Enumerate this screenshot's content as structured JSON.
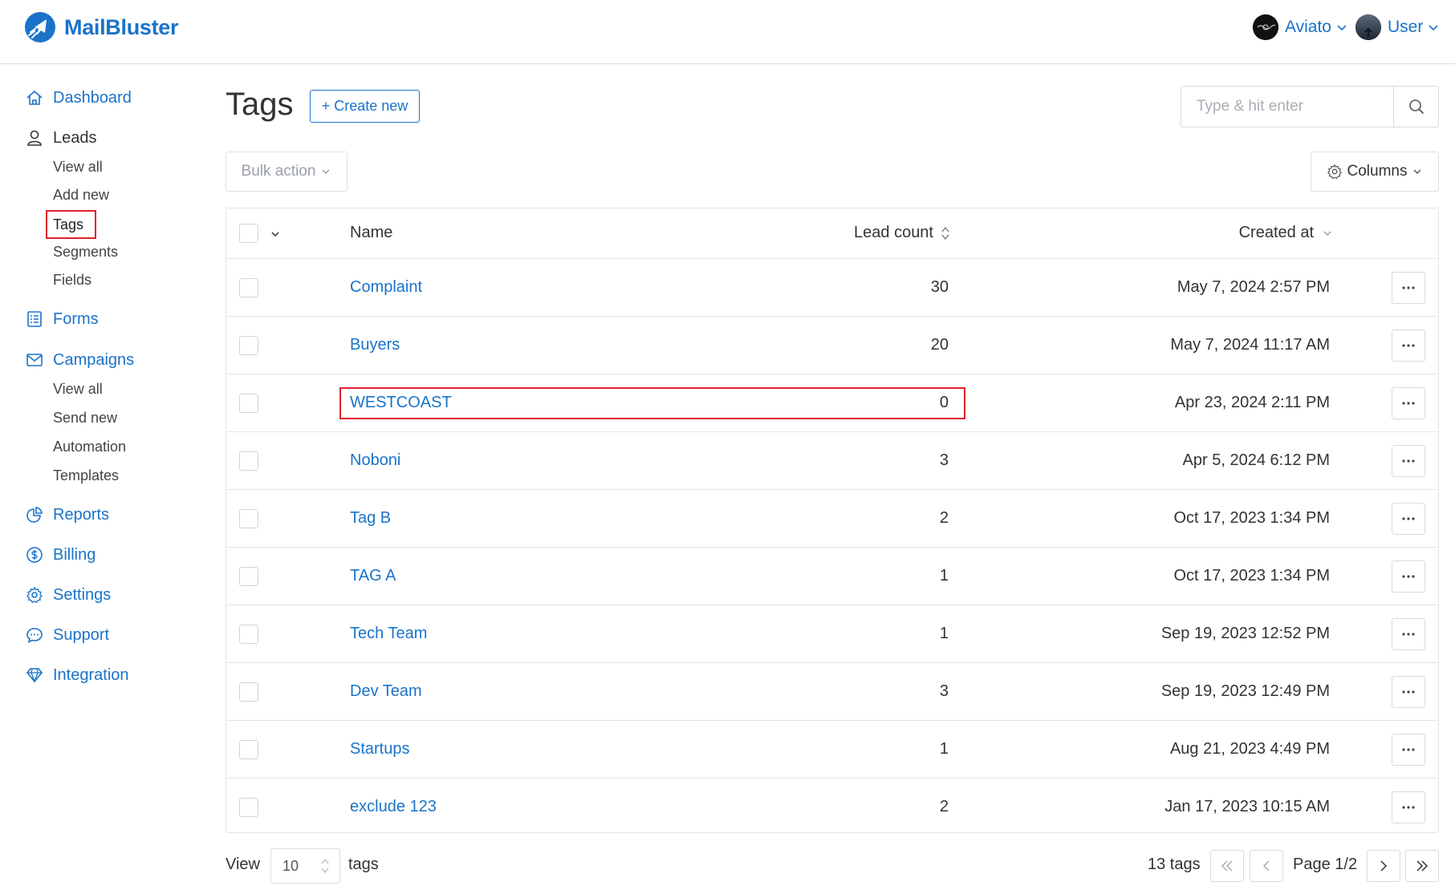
{
  "brand": {
    "name": "MailBluster",
    "accent": "#1a73c9"
  },
  "header": {
    "org": {
      "label": "Aviato",
      "icon": "chevron-down-icon"
    },
    "user": {
      "label": "User",
      "icon": "chevron-down-icon"
    }
  },
  "sidebar": {
    "items": [
      {
        "label": "Dashboard",
        "icon": "home-icon"
      },
      {
        "label": "Leads",
        "icon": "user-icon",
        "children": [
          "View all",
          "Add new",
          "Tags",
          "Segments",
          "Fields"
        ],
        "selected_child": "Tags"
      },
      {
        "label": "Forms",
        "icon": "form-icon"
      },
      {
        "label": "Campaigns",
        "icon": "envelope-icon",
        "children": [
          "View all",
          "Send new",
          "Automation",
          "Templates"
        ]
      },
      {
        "label": "Reports",
        "icon": "pie-chart-icon"
      },
      {
        "label": "Billing",
        "icon": "dollar-icon"
      },
      {
        "label": "Settings",
        "icon": "gear-icon"
      },
      {
        "label": "Support",
        "icon": "chat-icon"
      },
      {
        "label": "Integration",
        "icon": "diamond-icon"
      }
    ]
  },
  "main": {
    "title": "Tags",
    "create_label": "+ Create new",
    "search_placeholder": "Type & hit enter",
    "bulk_label": "Bulk action",
    "columns_label": "Columns"
  },
  "table": {
    "headers": {
      "name": "Name",
      "lead_count": "Lead count",
      "created_at": "Created at"
    },
    "rows": [
      {
        "name": "Complaint",
        "count": "30",
        "created": "May 7, 2024 2:57 PM"
      },
      {
        "name": "Buyers",
        "count": "20",
        "created": "May 7, 2024 11:17 AM"
      },
      {
        "name": "WESTCOAST",
        "count": "0",
        "created": "Apr 23, 2024 2:11 PM",
        "highlighted": true
      },
      {
        "name": "Noboni",
        "count": "3",
        "created": "Apr 5, 2024 6:12 PM"
      },
      {
        "name": "Tag B",
        "count": "2",
        "created": "Oct 17, 2023 1:34 PM"
      },
      {
        "name": "TAG A",
        "count": "1",
        "created": "Oct 17, 2023 1:34 PM"
      },
      {
        "name": "Tech Team",
        "count": "1",
        "created": "Sep 19, 2023 12:52 PM"
      },
      {
        "name": "Dev Team",
        "count": "3",
        "created": "Sep 19, 2023 12:49 PM"
      },
      {
        "name": "Startups",
        "count": "1",
        "created": "Aug 21, 2023 4:49 PM"
      },
      {
        "name": "exclude 123",
        "count": "2",
        "created": "Jan 17, 2023 10:15 AM"
      }
    ]
  },
  "footer": {
    "view_label": "View",
    "per_page": "10",
    "tags_label": "tags",
    "total": "13 tags",
    "page_label": "Page 1/2"
  },
  "colors": {
    "link": "#1a73c9",
    "highlight": "#e0212b",
    "border": "#e2e5ea"
  }
}
